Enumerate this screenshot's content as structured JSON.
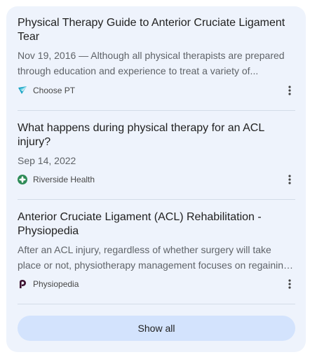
{
  "results": [
    {
      "title_line1": "Physical Therapy Guide to Anterior Cruciate Ligament",
      "title_line2": "Tear",
      "snippet_line1": "Nov 19, 2016 — Although all physical therapists are prepared",
      "snippet_line2": "through education and experience to treat a variety of...",
      "source": "Choose PT",
      "icon": "choose-pt-logo"
    },
    {
      "title_line1": "What happens during physical therapy for an ACL",
      "title_line2": "injury?",
      "snippet_line1": "Sep 14, 2022",
      "source": "Riverside Health",
      "icon": "riverside-health-logo"
    },
    {
      "title_line1": "Anterior Cruciate Ligament (ACL) Rehabilitation -",
      "title_line2": "Physiopedia",
      "snippet_line1": "After an ACL injury, regardless of whether surgery will take",
      "snippet_line2": "place or not, physiotherapy management focuses on regaining...",
      "source": "Physiopedia",
      "icon": "physiopedia-logo"
    }
  ],
  "show_all_label": "Show all",
  "more_icon": "more-vert-icon",
  "colors": {
    "card_bg": "#eef3fc",
    "button_bg": "#d3e3fd",
    "choose_pt": "#1aa3c4",
    "riverside": "#2e8b57",
    "physiopedia": "#3d1230"
  }
}
